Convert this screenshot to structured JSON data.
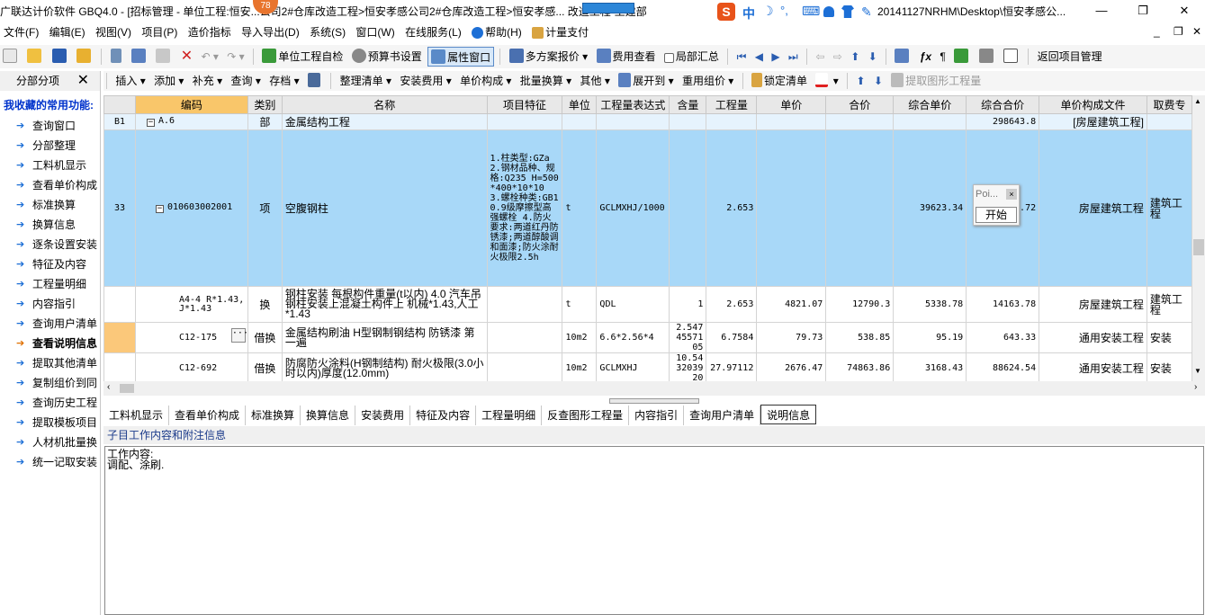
{
  "window": {
    "title": "广联达计价软件 GBQ4.0 - [招标管理 - 单位工程:恒安...公司2#仓库改造工程>恒安孝感公司2#仓库改造工程>恒安孝感... 改造工程-土建部",
    "title_tail": "20141127NRHM\\Desktop\\恒安孝感公...",
    "badge": "78",
    "minimize": "—",
    "restore": "❐",
    "close": "✕"
  },
  "ime": {
    "lang": "中",
    "moon": "☽",
    "dot": "°,",
    "kb": "⌨"
  },
  "menu": [
    "文件(F)",
    "编辑(E)",
    "视图(V)",
    "项目(P)",
    "造价指标",
    "导入导出(D)",
    "系统(S)",
    "窗口(W)",
    "在线服务(L)",
    "帮助(H)",
    "计量支付"
  ],
  "mdi": {
    "min": "_",
    "restore": "❐",
    "close": "✕"
  },
  "toolbar1": {
    "unit_check": "单位工程自检",
    "budget_settings": "预算书设置",
    "property_window": "属性窗口",
    "multi_quote": "多方案报价",
    "fee_view": "费用查看",
    "local_summary": "局部汇总",
    "back_project": "返回项目管理"
  },
  "toolbar2": {
    "insert": "插入",
    "add": "添加",
    "supplement": "补充",
    "query": "查询",
    "archive": "存档",
    "organize": "整理清单",
    "install_fee": "安装费用",
    "unit_comp": "单价构成",
    "batch_convert": "批量换算",
    "other": "其他",
    "expand_to": "展开到",
    "reuse_price": "重用组价",
    "lock_list": "锁定清单",
    "extract_graphic": "提取图形工程量"
  },
  "left_panel": {
    "title": "分部分项",
    "close": "✕",
    "favorites": "我收藏的常用功能:",
    "items": [
      "查询窗口",
      "分部整理",
      "工料机显示",
      "查看单价构成",
      "标准换算",
      "换算信息",
      "逐条设置安装",
      "特征及内容",
      "工程量明细",
      "内容指引",
      "查询用户清单",
      "查看说明信息",
      "提取其他清单",
      "复制组价到同",
      "查询历史工程",
      "提取模板项目",
      "人材机批量换",
      "统一记取安装"
    ]
  },
  "grid": {
    "columns": [
      "",
      "编码",
      "类别",
      "名称",
      "项目特征",
      "单位",
      "工程量表达式",
      "含量",
      "工程量",
      "单价",
      "合价",
      "综合单价",
      "综合合价",
      "单价构成文件",
      "取费专"
    ],
    "rows": [
      {
        "no": "B1",
        "code": "A.6",
        "type": "部",
        "name": "金属结构工程",
        "feature": "",
        "unit": "",
        "expr": "",
        "qty_ratio": "",
        "qty": "",
        "price": "",
        "total": "",
        "comp_price": "",
        "comp_total": "298643.8",
        "file": "[房屋建筑工程]",
        "fee": ""
      },
      {
        "no": "33",
        "code": "010603002001",
        "type": "项",
        "name": "空腹钢柱",
        "feature": "1.柱类型:GZa 2.钢材品种、规格:Q235 H=500*400*10*10 3.螺栓种类:GB10.9级摩擦型高强螺栓 4.防火要求:两道红丹防锈漆;两道醇酸调和面漆;防火涂耐火极限2.5h",
        "unit": "t",
        "expr": "GCLMXHJ/1000",
        "qty_ratio": "",
        "qty": "2.653",
        "price": "",
        "total": "",
        "comp_price": "39623.34",
        "comp_total": ".72",
        "file": "房屋建筑工程",
        "fee": "建筑工程"
      },
      {
        "no": "",
        "code": "A4-4 R*1.43, J*1.43",
        "type": "换",
        "name": "钢柱安装 每根构件重量(t以内) 4.0 汽车吊 钢柱安装上混凝土构件上 机械*1.43,人工*1.43",
        "feature": "",
        "unit": "t",
        "expr": "QDL",
        "qty_ratio": "1",
        "qty": "2.653",
        "price": "4821.07",
        "total": "12790.3",
        "comp_price": "5338.78",
        "comp_total": "14163.78",
        "file": "房屋建筑工程",
        "fee": "建筑工程"
      },
      {
        "no": "",
        "code": "C12-175",
        "type": "借换",
        "name": "金属结构刷油 H型钢制钢结构 防锈漆 第一遍",
        "feature": "",
        "unit": "10m2",
        "expr": "6.6*2.56*4",
        "qty_ratio": "2.5474557105",
        "qty": "6.7584",
        "price": "79.73",
        "total": "538.85",
        "comp_price": "95.19",
        "comp_total": "643.33",
        "file": "通用安装工程",
        "fee": "安装"
      },
      {
        "no": "",
        "code": "C12-692",
        "type": "借换",
        "name": "防腐防火涂料(H钢制结构) 耐火极限(3.0小时以内)厚度(12.0mm)",
        "feature": "",
        "unit": "10m2",
        "expr": "GCLMXHJ",
        "qty_ratio": "10.543203920",
        "qty": "27.97112",
        "price": "2676.47",
        "total": "74863.86",
        "comp_price": "3168.43",
        "comp_total": "88624.54",
        "file": "通用安装工程",
        "fee": "安装"
      },
      {
        "no": "",
        "code": "",
        "type": "",
        "name": "金属结构刷油 H型钢制钢结构 防锈漆 第",
        "feature": "",
        "unit": "",
        "expr": "",
        "qty_ratio": "2.5474",
        "qty": "",
        "price": "",
        "total": "",
        "comp_price": "",
        "comp_total": "",
        "file": "",
        "fee": ""
      }
    ]
  },
  "popup": {
    "title": "Poi...",
    "button": "开始"
  },
  "bottom_tabs": [
    "工料机显示",
    "查看单价构成",
    "标准换算",
    "换算信息",
    "安装费用",
    "特征及内容",
    "工程量明细",
    "反查图形工程量",
    "内容指引",
    "查询用户清单",
    "说明信息"
  ],
  "active_bottom_tab": "说明信息",
  "subhead": "子目工作内容和附注信息",
  "content_lines": [
    "工作内容:",
    "调配、涂刷."
  ]
}
